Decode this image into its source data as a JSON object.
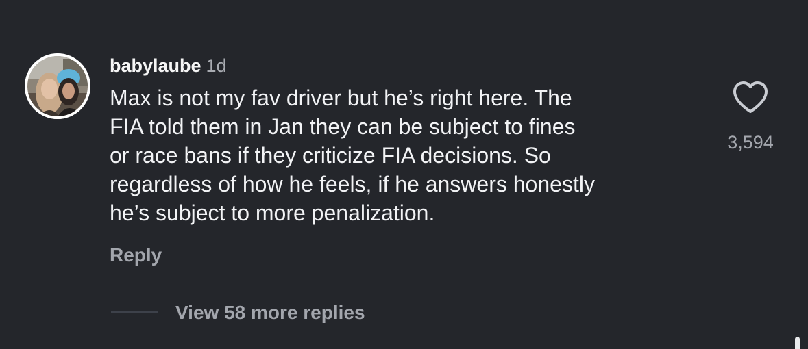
{
  "comment": {
    "username": "babylaube",
    "time": "1d",
    "text_lines": [
      "Max is not my fav driver but he’s right here. The",
      "FIA told them in Jan they can be subject to fines",
      "or race bans if they criticize FIA decisions. So",
      "regardless of how he feels, if he answers honestly",
      "he’s subject to more penalization."
    ],
    "reply_label": "Reply",
    "likes": "3,594",
    "like_icon": "heart-outline-icon",
    "avatar_icon": "profile-photo"
  },
  "replies": {
    "view_more_label": "View 58 more replies"
  },
  "colors": {
    "background": "#24262b",
    "primary_text": "#f2f3f5",
    "secondary_text": "#a3a6ad"
  }
}
